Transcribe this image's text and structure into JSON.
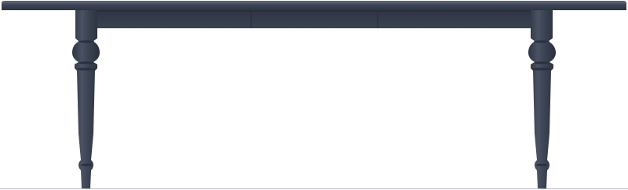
{
  "image": {
    "subject": "dining-table",
    "colors": {
      "paint": "#3b4252",
      "paint_shadow": "#2e3441",
      "paint_highlight": "#5a6274",
      "background": "#ffffff",
      "floor_line": "#9aa0aa"
    }
  }
}
